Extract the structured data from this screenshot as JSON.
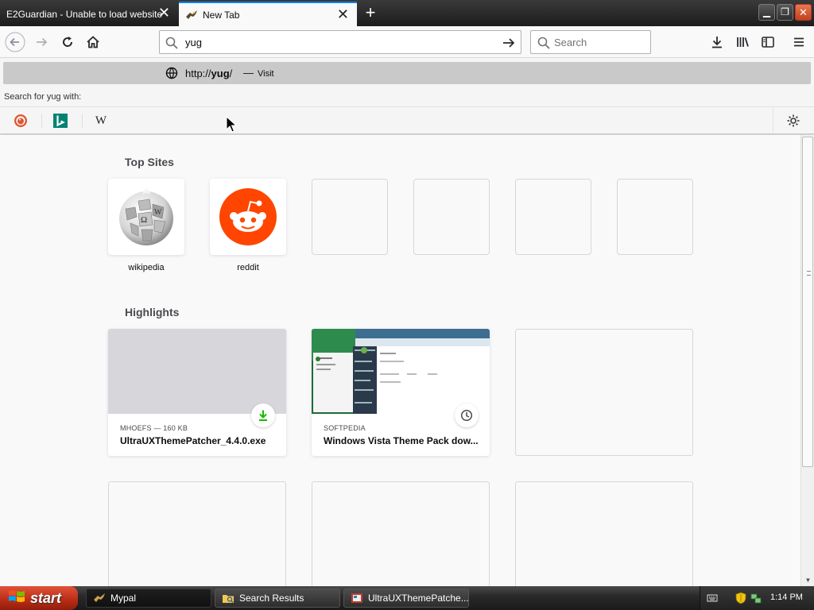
{
  "colors": {
    "accent": "#0a84ff",
    "reddit_orange": "#ff4500",
    "download_green": "#12bc00",
    "bing_teal": "#008373",
    "ddg_orange": "#de5833",
    "start_red": "#c0331b"
  },
  "tabs": [
    {
      "title": "E2Guardian - Unable to load website",
      "active": false,
      "close_icon": "close-icon"
    },
    {
      "title": "New Tab",
      "active": true,
      "favicon": "mypal-icon",
      "close_icon": "close-icon"
    }
  ],
  "window_controls": {
    "minimize": "minimize-icon",
    "maximize": "restore-icon",
    "close": "close-icon"
  },
  "navbar": {
    "back_icon": "back-arrow-icon",
    "forward_icon": "forward-arrow-icon",
    "reload_icon": "reload-icon",
    "home_icon": "home-icon",
    "url_value": "yug",
    "go_icon": "go-arrow-icon",
    "search_placeholder": "Search",
    "downloads_icon": "download-icon",
    "library_icon": "library-icon",
    "sidebar_icon": "sidebar-icon",
    "menu_icon": "hamburger-menu-icon"
  },
  "popup": {
    "suggestion_prefix": "http://",
    "suggestion_bold": "yug",
    "suggestion_suffix": "/",
    "suggestion_dash": "—",
    "suggestion_action": "Visit",
    "search_for_prefix": "Search for",
    "search_for_term": "yug",
    "search_for_suffix": "with:",
    "engines": [
      {
        "name": "DuckDuckGo",
        "icon": "duckduckgo-icon"
      },
      {
        "name": "Bing",
        "icon": "bing-icon",
        "glyph": "b"
      },
      {
        "name": "Wikipedia",
        "icon": "wikipedia-icon",
        "glyph": "W"
      }
    ],
    "settings_icon": "gear-icon"
  },
  "top_sites": {
    "title": "Top Sites",
    "sites": [
      {
        "label": "wikipedia",
        "icon": "wikipedia-globe-icon"
      },
      {
        "label": "reddit",
        "icon": "reddit-icon"
      }
    ],
    "empty_slots": 4
  },
  "highlights": {
    "title": "Highlights",
    "cards": [
      {
        "context": "MHOEFS — 160 KB",
        "title": "UltraUXThemePatcher_4.4.0.exe",
        "badge_icon": "download-icon"
      },
      {
        "context": "SOFTPEDIA",
        "title": "Windows Vista Theme Pack dow...",
        "badge_icon": "clock-icon"
      }
    ]
  },
  "taskbar": {
    "start_label": "start",
    "items": [
      {
        "label": "Mypal",
        "icon": "mypal-icon",
        "active": true
      },
      {
        "label": "Search Results",
        "icon": "folder-search-icon",
        "active": false
      },
      {
        "label": "UltraUXThemePatche...",
        "icon": "installer-icon",
        "active": false
      }
    ],
    "clock": "1:14 PM"
  }
}
